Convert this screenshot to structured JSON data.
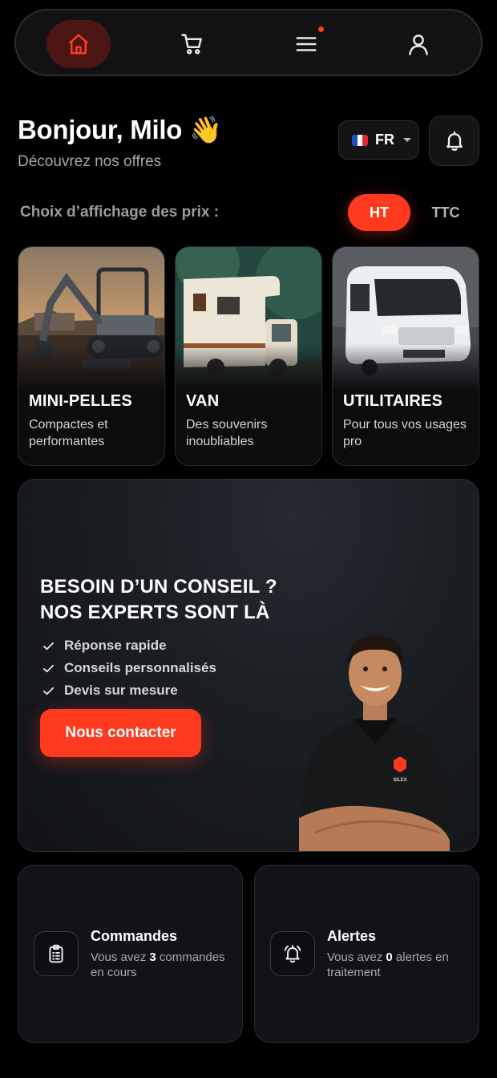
{
  "nav": {
    "items": [
      {
        "name": "home",
        "icon": "home-icon",
        "active": true
      },
      {
        "name": "cart",
        "icon": "cart-icon",
        "active": false
      },
      {
        "name": "menu",
        "icon": "menu-icon",
        "active": false,
        "badge": true
      },
      {
        "name": "profile",
        "icon": "user-icon",
        "active": false
      }
    ],
    "accent": "#ff3a1e"
  },
  "header": {
    "greeting": "Bonjour, Milo 👋",
    "subtitle": "Découvrez nos offres",
    "language": "FR",
    "language_flag": "flag-fr-icon"
  },
  "price_display": {
    "label": "Choix d’affichage des prix :",
    "options": [
      "HT",
      "TTC"
    ],
    "selected": "HT"
  },
  "categories": [
    {
      "title": "MINI-PELLES",
      "description": "Compactes et performantes"
    },
    {
      "title": "VAN",
      "description": "Des souvenirs inoubliables"
    },
    {
      "title": "UTILITAIRES",
      "description": "Pour tous vos usages pro"
    }
  ],
  "advisor": {
    "title_line1": "BESOIN D’UN CONSEIL ?",
    "title_line2": "NOS EXPERTS SONT LÀ",
    "checks": [
      "Réponse rapide",
      "Conseils personnalisés",
      "Devis sur mesure"
    ],
    "button": "Nous contacter",
    "shirt_logo": "SILEX"
  },
  "orders": {
    "title": "Commandes",
    "text_prefix": "Vous avez",
    "count": "3",
    "text_suffix": "commandes en cours"
  },
  "alerts": {
    "title": "Alertes",
    "text_prefix": "Vous avez",
    "count": "0",
    "text_suffix": "alertes en traitement"
  }
}
